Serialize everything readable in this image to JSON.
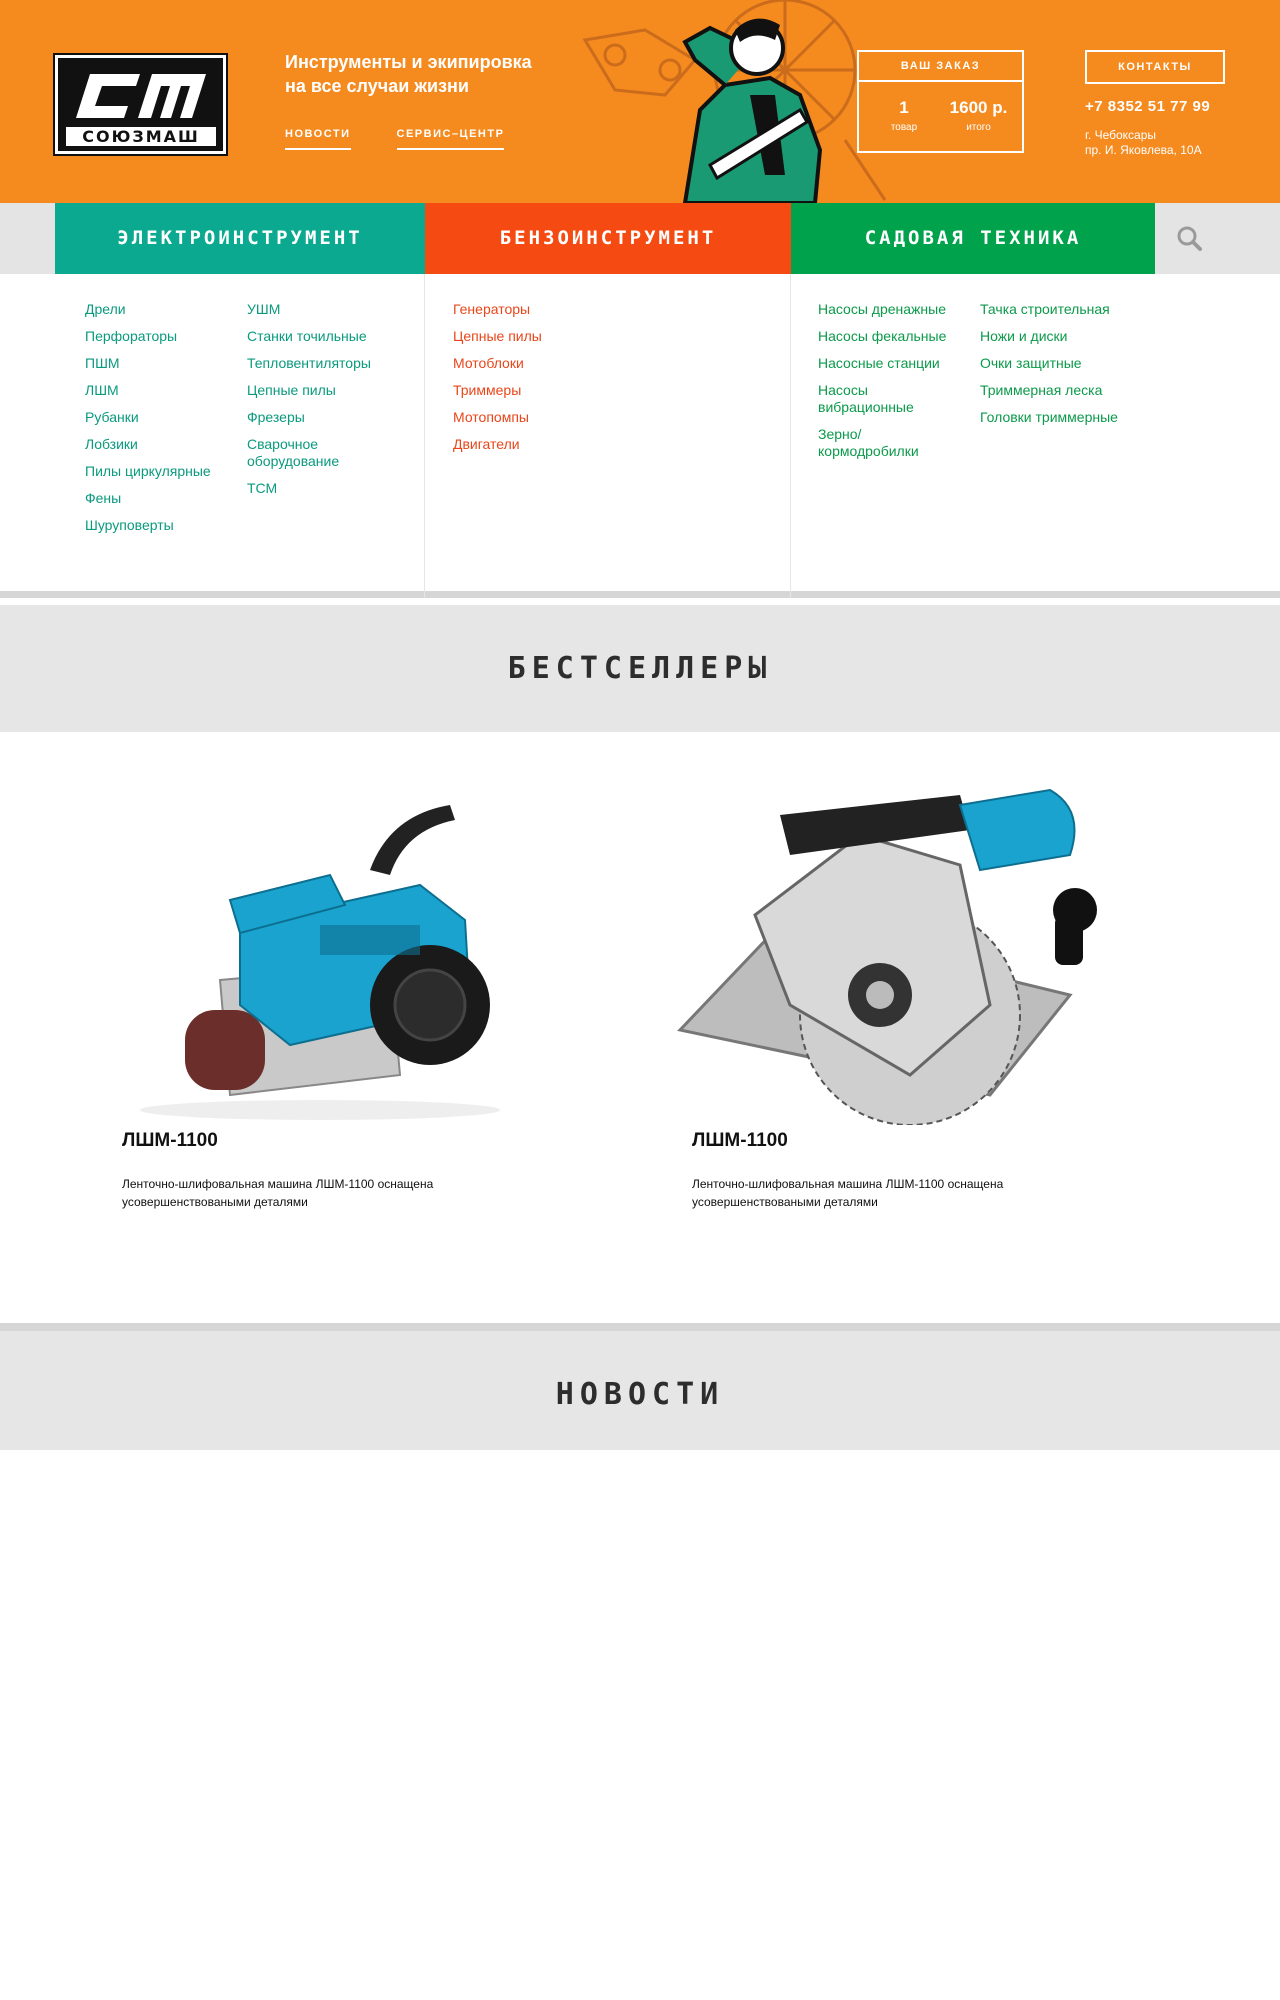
{
  "header": {
    "logo_text": "СОЮЗМАШ",
    "tagline": [
      "Инструменты и экипировка",
      "на все случаи жизни"
    ],
    "links": [
      "НОВОСТИ",
      "СЕРВИС–ЦЕНТР"
    ],
    "cart": {
      "title": "ВАШ ЗАКАЗ",
      "count": "1",
      "count_label": "товар",
      "total": "1600 р.",
      "total_label": "итого"
    },
    "contacts_label": "КОНТАКТЫ",
    "phone": "+7 8352 51 77 99",
    "address": [
      "г. Чебоксары",
      "пр. И. Яковлева, 10А"
    ]
  },
  "nav": {
    "tabs": [
      "ЭЛЕКТРОИНСТРУМЕНТ",
      "БЕНЗОИНСТРУМЕНТ",
      "САДОВАЯ ТЕХНИКА"
    ],
    "search_icon": "search-icon"
  },
  "menu": {
    "electro_a": [
      "Дрели",
      "Перфораторы",
      "ПШМ",
      "ЛШМ",
      "Рубанки",
      "Лобзики",
      "Пилы циркулярные",
      "Фены",
      "Шуруповерты"
    ],
    "electro_b": [
      "УШМ",
      "Станки точильные",
      "Тепловентиляторы",
      "Цепные пилы",
      "Фрезеры",
      "Сварочное оборудование",
      "ТСМ"
    ],
    "petrol": [
      "Генераторы",
      "Цепные пилы",
      "Мотоблоки",
      "Триммеры",
      "Мотопомпы",
      "Двигатели"
    ],
    "garden_a": [
      "Насосы дренажные",
      "Насосы фекальные",
      "Насосные станции",
      "Насосы вибрационные",
      "Зерно/ кормодробилки"
    ],
    "garden_b": [
      "Тачка строительная",
      "Ножи и диски",
      "Очки защитные",
      "Триммерная леска",
      "Головки триммерные"
    ]
  },
  "sections": {
    "bestsellers": "БЕСТСЕЛЛЕРЫ",
    "news": "НОВОСТИ"
  },
  "products": [
    {
      "name": "ЛШМ-1100",
      "description": "Ленточно-шлифовальная машина ЛШМ-1100 оснащена усовершенствоваными деталями"
    },
    {
      "name": "ЛШМ-1100",
      "description": "Ленточно-шлифовальная машина ЛШМ-1100 оснащена усовершенствоваными деталями"
    }
  ],
  "colors": {
    "header_bg": "#f58a1f",
    "electro": "#0aa990",
    "petrol": "#f54b12",
    "garden": "#00a24c"
  }
}
